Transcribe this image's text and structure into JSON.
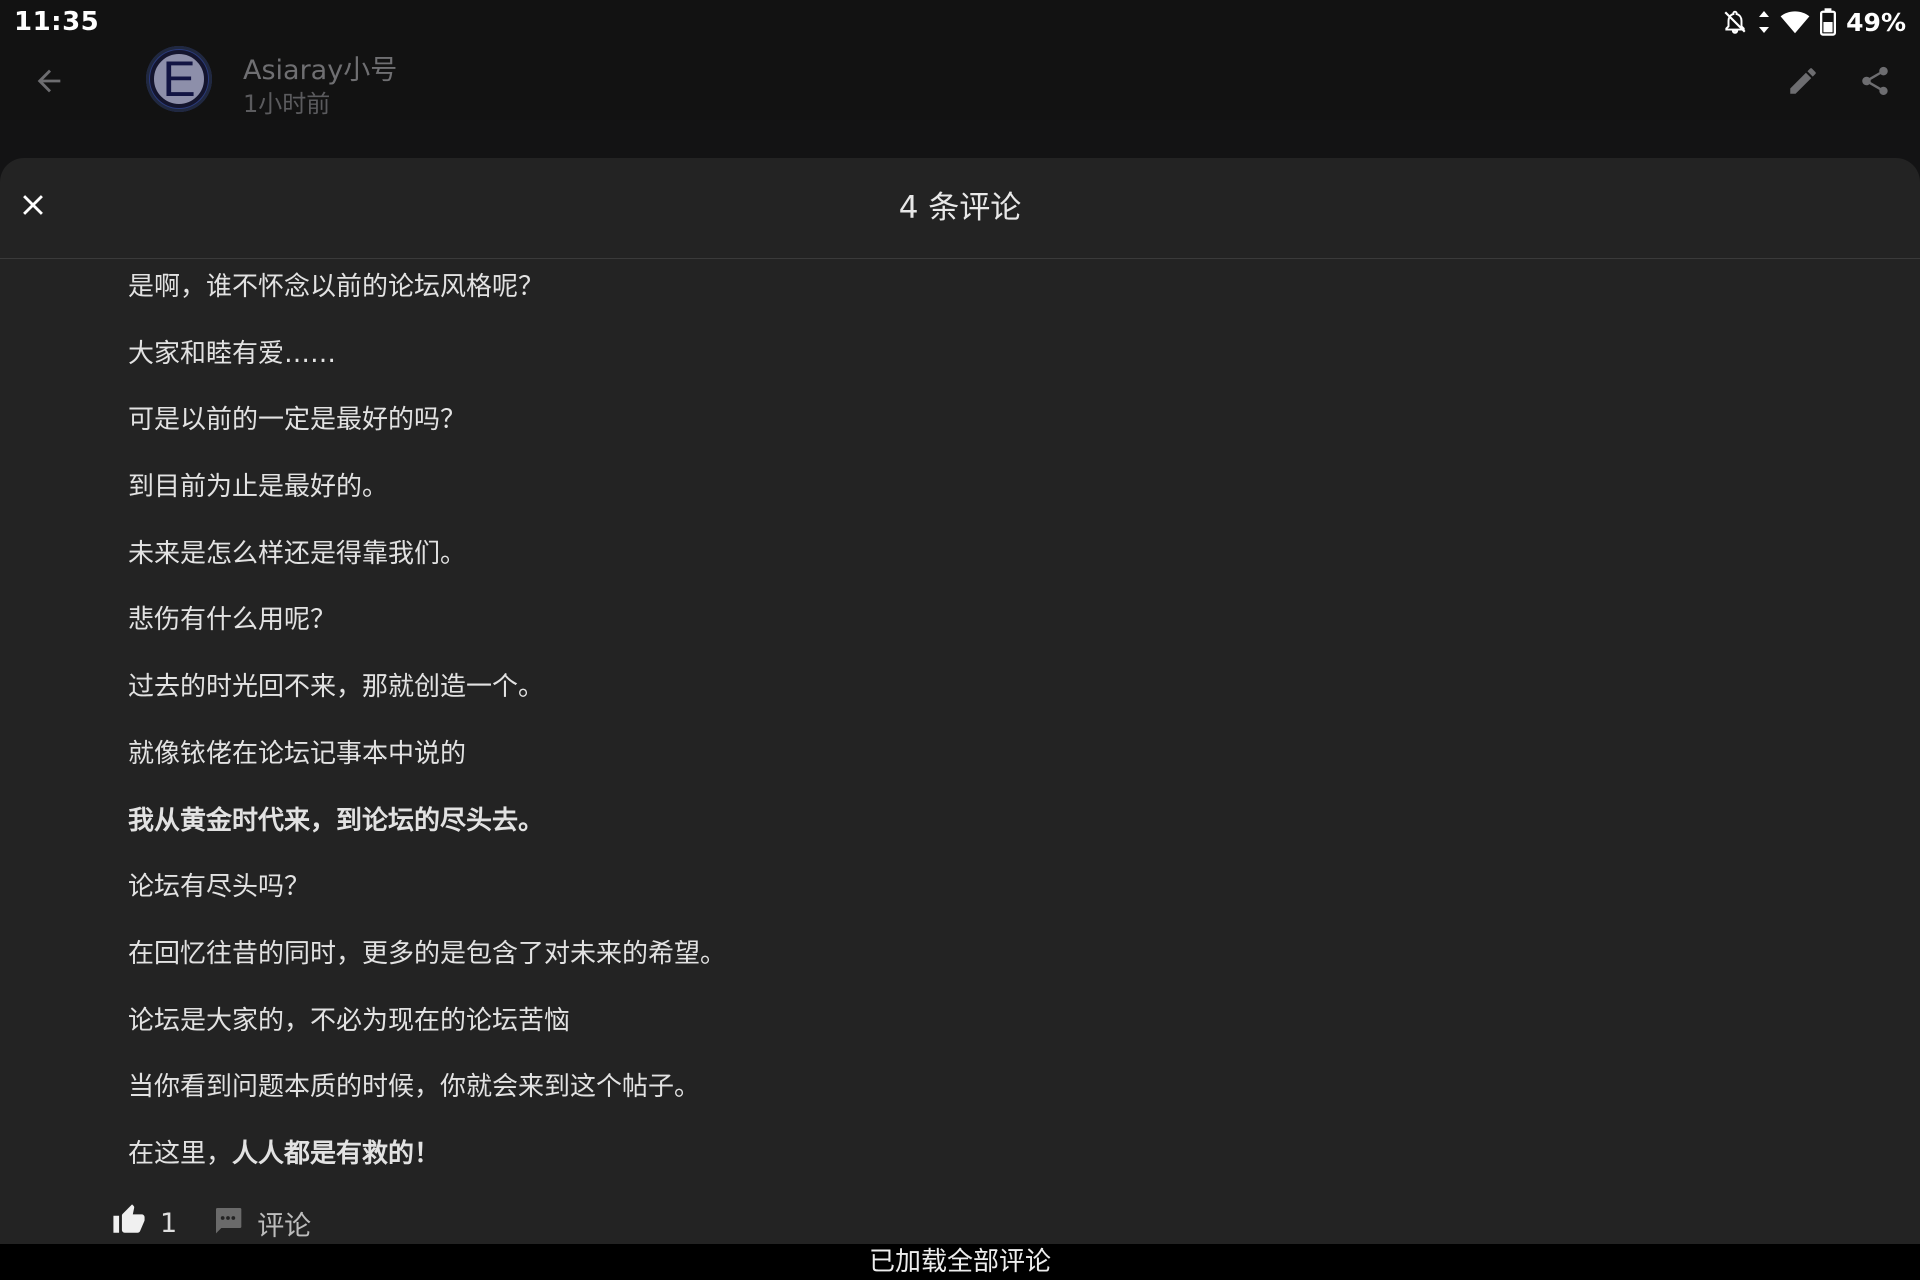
{
  "status_bar": {
    "time": "11:35",
    "battery_percent": "49%",
    "icons": [
      "notifications-off-icon",
      "data-arrows-icon",
      "wifi-icon",
      "battery-icon"
    ]
  },
  "app_bar": {
    "author_name": "Asiaray小号",
    "post_time": "1小时前",
    "avatar_letter": "E",
    "icons": [
      "back-arrow-icon",
      "pencil-icon",
      "share-icon"
    ]
  },
  "comments_sheet": {
    "title": "4 条评论",
    "lines": [
      "是啊，谁不怀念以前的论坛风格呢？",
      "大家和睦有爱……",
      "可是以前的一定是最好的吗？",
      "到目前为止是最好的。",
      "未来是怎么样还是得靠我们。",
      "悲伤有什么用呢？",
      "过去的时光回不来，那就创造一个。",
      "就像铱佬在论坛记事本中说的",
      "我从黄金时代来，到论坛的尽头去。",
      "论坛有尽头吗？",
      "在回忆往昔的同时，更多的是包含了对未来的希望。",
      "论坛是大家的，不必为现在的论坛苦恼",
      "当你看到问题本质的时候，你就会来到这个帖子。"
    ],
    "last_line_prefix": "在这里，",
    "last_line_bold": "人人都是有救的！",
    "like_count": "1",
    "reply_label": "评论"
  },
  "footer": {
    "text": "已加载全部评论"
  },
  "colors": {
    "sheet_background": "#232323",
    "app_bar_background": "#121212",
    "footer_background": "#000000",
    "avatar_ring": "#2a3a7a"
  }
}
